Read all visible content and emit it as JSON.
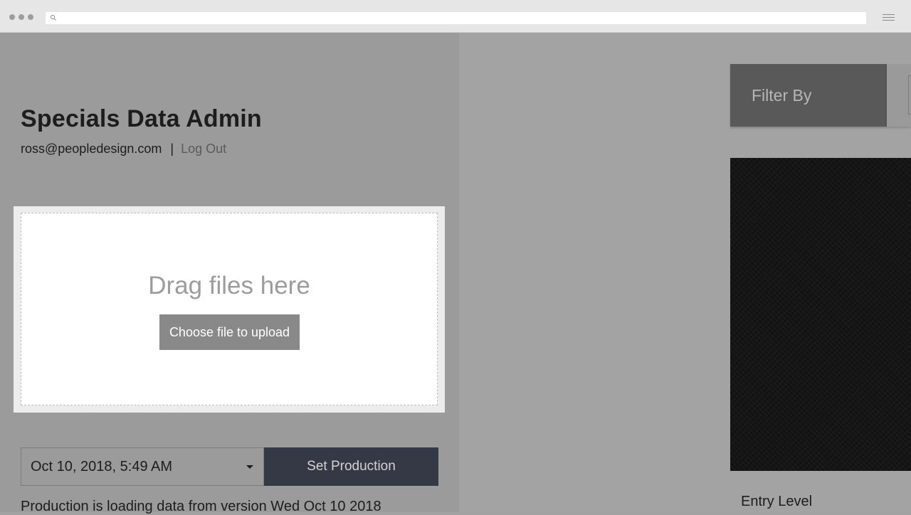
{
  "browser": {
    "url": ""
  },
  "admin": {
    "title": "Specials Data Admin",
    "user_email": "ross@peopledesign.com",
    "separator": "|",
    "logout_label": "Log Out"
  },
  "upload": {
    "drag_text": "Drag files here",
    "choose_label": "Choose file to upload"
  },
  "production": {
    "selected_version": "Oct 10, 2018, 5:49 AM",
    "set_label": "Set Production",
    "status": "Production is loading data from version Wed Oct 10 2018"
  },
  "filters": {
    "label": "Filter By"
  },
  "card": {
    "caption": "Entry Level"
  },
  "colors": {
    "set_production_button": "#353845",
    "filter_box": "#595959",
    "panel_background": "#9b9b9b"
  }
}
